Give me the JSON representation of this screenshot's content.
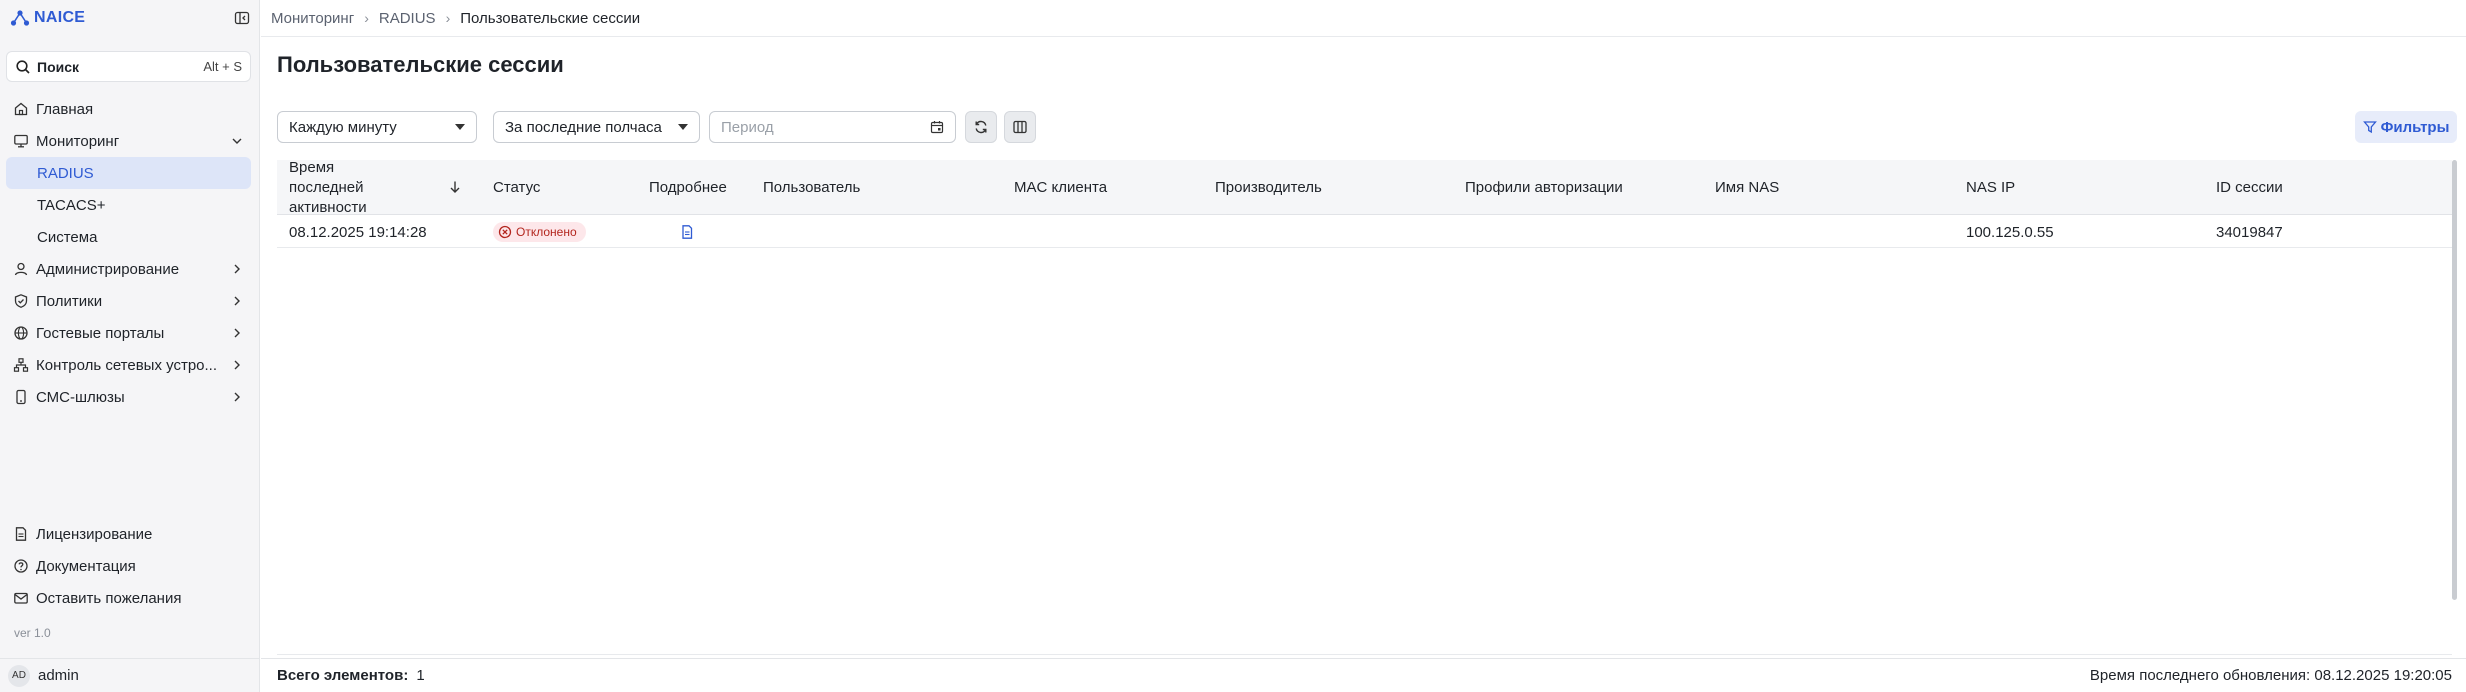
{
  "app": {
    "name": "NAICE",
    "version": "ver 1.0"
  },
  "search": {
    "label": "Поиск",
    "shortcut": "Alt + S"
  },
  "nav": {
    "home": "Главная",
    "monitoring": "Мониторинг",
    "radius": "RADIUS",
    "tacacs": "TACACS+",
    "system": "Система",
    "administration": "Администрирование",
    "policies": "Политики",
    "guest_portals": "Гостевые порталы",
    "network_devices": "Контроль сетевых устро...",
    "sms_gateways": "СМС-шлюзы"
  },
  "bottom_nav": {
    "licensing": "Лицензирование",
    "docs": "Документация",
    "feedback": "Оставить пожелания"
  },
  "user": {
    "initials": "AD",
    "name": "admin"
  },
  "breadcrumb": [
    "Мониторинг",
    "RADIUS",
    "Пользовательские сессии"
  ],
  "page": {
    "title": "Пользовательские сессии"
  },
  "toolbar": {
    "refresh_interval": "Каждую минуту",
    "time_range": "За последние полчаса",
    "period_placeholder": "Период",
    "filters_label": "Фильтры"
  },
  "table": {
    "columns": [
      "Время последней активности",
      "Статус",
      "Подробнее",
      "Пользователь",
      "MAC клиента",
      "Производитель",
      "Профили авторизации",
      "Имя NAS",
      "NAS IP",
      "ID сессии"
    ],
    "rows": [
      {
        "last_activity": "08.12.2025 19:14:28",
        "status": "Отклонено",
        "user": "",
        "mac": "",
        "vendor": "",
        "profiles": "",
        "nas_name": "",
        "nas_ip": "100.125.0.55",
        "session_id": "34019847"
      }
    ]
  },
  "footer": {
    "total_label": "Всего элементов:",
    "total_value": "1",
    "updated": "Время последнего обновления: 08.12.2025 19:20:05"
  },
  "colors": {
    "accent": "#2f5bd3",
    "active_bg": "#dde5f8",
    "rejected_bg": "#fde7ea",
    "rejected_fg": "#b3261e"
  }
}
